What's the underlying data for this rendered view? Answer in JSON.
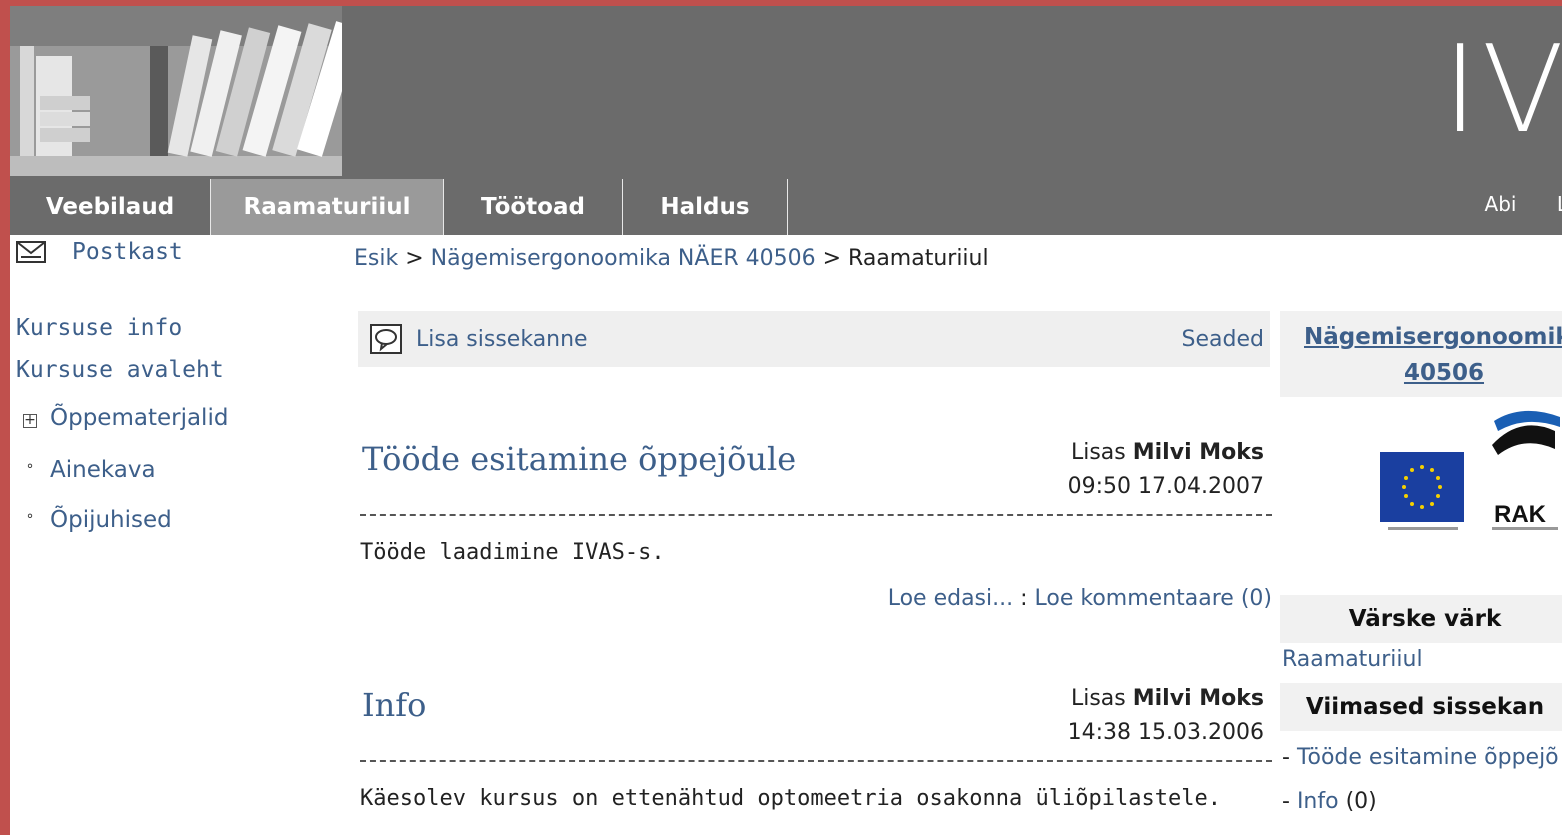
{
  "header": {
    "logo_text": "IV",
    "util_links": [
      "Abi",
      "L"
    ]
  },
  "tabs": [
    {
      "label": "Veebilaud"
    },
    {
      "label": "Raamaturiiul"
    },
    {
      "label": "Töötoad"
    },
    {
      "label": "Haldus"
    }
  ],
  "sidebar": {
    "postkast": "Postkast",
    "links": [
      "Kursuse info",
      "Kursuse avaleht"
    ],
    "tree": [
      {
        "label": "Õppematerjalid",
        "marker": "plus"
      },
      {
        "label": "Ainekava",
        "marker": "circle"
      },
      {
        "label": "Õpijuhised",
        "marker": "circle"
      }
    ]
  },
  "breadcrumb": {
    "home": "Esik",
    "sep": " > ",
    "course": "Nägemisergonoomika NÄER 40506",
    "current": "Raamaturiiul"
  },
  "toolbar": {
    "add_entry": "Lisa sissekanne",
    "settings": "Seaded"
  },
  "posts": [
    {
      "title": "Tööde esitamine õppejõule",
      "added_by_label": "Lisas",
      "author": "Milvi Moks",
      "datetime": "09:50 17.04.2007",
      "body": "Tööde laadimine IVAS-s.",
      "read_more": "Loe edasi...",
      "link_sep": " : ",
      "comments": "Loe kommentaare (0)"
    },
    {
      "title": "Info",
      "added_by_label": "Lisas",
      "author": "Milvi Moks",
      "datetime": "14:38 15.03.2006",
      "body": "Käesolev kursus on ettenähtud optomeetria osakonna üliõpilastele."
    }
  ],
  "right_panel": {
    "course_title_line1": "Nägemisergonoomika",
    "course_title_line2": "40506",
    "logo_rak": "RAK",
    "fresh_heading": "Värske värk",
    "fresh_link": "Raamaturiiul",
    "recent_heading": "Viimased sissekan",
    "recent_items": [
      {
        "prefix": "- ",
        "label": "Tööde esitamine õppejõ",
        "suffix": ""
      },
      {
        "prefix": "- ",
        "label": "Info",
        "suffix": " (0)"
      }
    ]
  },
  "colors": {
    "frame": "#c0504d",
    "header": "#6b6b6b",
    "active_tab": "#9a9a9a",
    "link": "#3d5f8a",
    "eu_blue": "#1a3fa0"
  }
}
